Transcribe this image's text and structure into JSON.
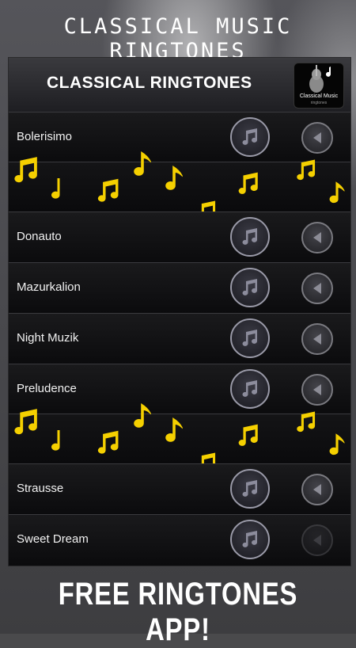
{
  "banner_top": "CLASSICAL MUSIC RINGTONES",
  "header": {
    "title": "CLASSICAL RINGTONES",
    "logo_line1": "Classical Music",
    "logo_line2": "ringtones"
  },
  "ringtones": [
    {
      "name": "Bolerisimo"
    },
    {
      "name": "Donauto"
    },
    {
      "name": "Mazurkalion"
    },
    {
      "name": "Night Muzik"
    },
    {
      "name": "Preludence"
    },
    {
      "name": "Strausse"
    },
    {
      "name": "Sweet Dream"
    }
  ],
  "banner_bottom": "FREE RINGTONES APP!",
  "colors": {
    "note_gold": "#f5d000",
    "panel_bg": "#0c0c0e",
    "button_ring": "#9a9aa8"
  },
  "icons": {
    "play": "music-note-icon",
    "action": "triangle-left-icon",
    "decor": "gold-music-note-icon"
  }
}
